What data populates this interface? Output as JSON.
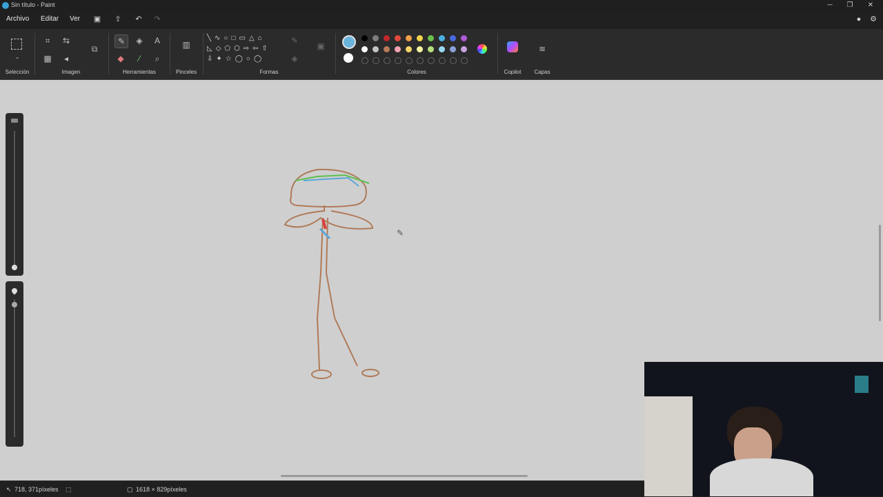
{
  "window": {
    "title": "Sin título - Paint",
    "minimize": "─",
    "restore": "❐",
    "close": "✕"
  },
  "menu": {
    "file": "Archivo",
    "edit": "Editar",
    "view": "Ver"
  },
  "ribbon": {
    "groups": {
      "selection": "Selección",
      "image": "Imagen",
      "tools": "Herramientas",
      "brushes": "Pinceles",
      "shapes": "Formas",
      "colors": "Colores",
      "copilot": "Copilot",
      "layers": "Capas"
    },
    "active_color": "#6ab4dc",
    "secondary_color": "#ffffff",
    "palette_row1": [
      "#000000",
      "#7f7f7f",
      "#c1272d",
      "#e0483e",
      "#f0a04a",
      "#f2d24a",
      "#6cc04a",
      "#4ab0e0",
      "#4a6ae0",
      "#b05ad8"
    ],
    "palette_row2": [
      "#ffffff",
      "#c3c3c3",
      "#b97a57",
      "#f2a2b0",
      "#f5d46a",
      "#f2f2a0",
      "#b5e07a",
      "#9ad8f0",
      "#8aa0d8",
      "#c8a2e0"
    ]
  },
  "status": {
    "cursor_position": "718, 371píxeles",
    "canvas_size": "1618 × 829píxeles"
  }
}
